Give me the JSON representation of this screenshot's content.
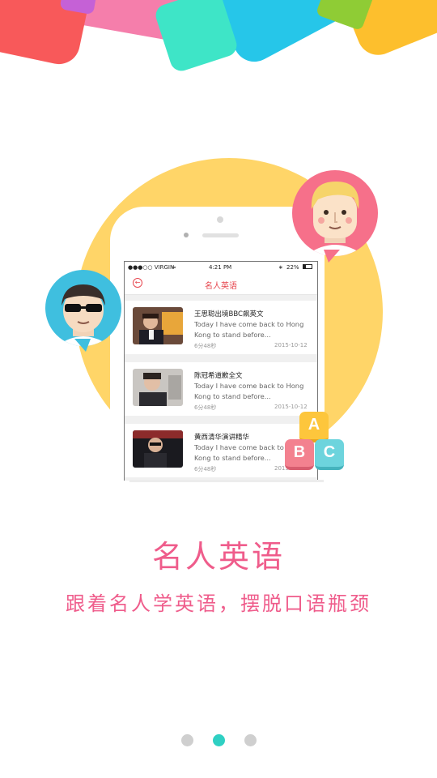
{
  "colors": {
    "accent_pink": "#ef5c8b",
    "accent_red": "#e7474f",
    "circle_yellow": "#ffd568",
    "dot_active": "#2fd0c3",
    "dot_inactive": "#cfcfcf"
  },
  "phone": {
    "status": {
      "carrier": "●●●○○ VIRGIN",
      "time": "4:21 PM",
      "battery": "22%"
    },
    "nav": {
      "back_icon": "back-arrow-icon",
      "title": "名人英语"
    },
    "items": [
      {
        "title": "王思聪出境BBC飙英文",
        "desc": "Today I have come back to Hong Kong to stand before...",
        "duration": "6分48秒",
        "date": "2015-10-12"
      },
      {
        "title": "陈冠希道歉全文",
        "desc": "Today I have come back to Hong Kong to stand before...",
        "duration": "6分48秒",
        "date": "2015-10-12"
      },
      {
        "title": "黄西清华演讲精华",
        "desc": "Today I have come back to Hong Kong to stand before...",
        "duration": "6分48秒",
        "date": "2015-10-12"
      }
    ]
  },
  "blocks": {
    "a": "A",
    "b": "B",
    "c": "C"
  },
  "heading": "名人英语",
  "subheading": "跟着名人学英语，摆脱口语瓶颈",
  "pager": {
    "count": 3,
    "active_index": 1
  }
}
